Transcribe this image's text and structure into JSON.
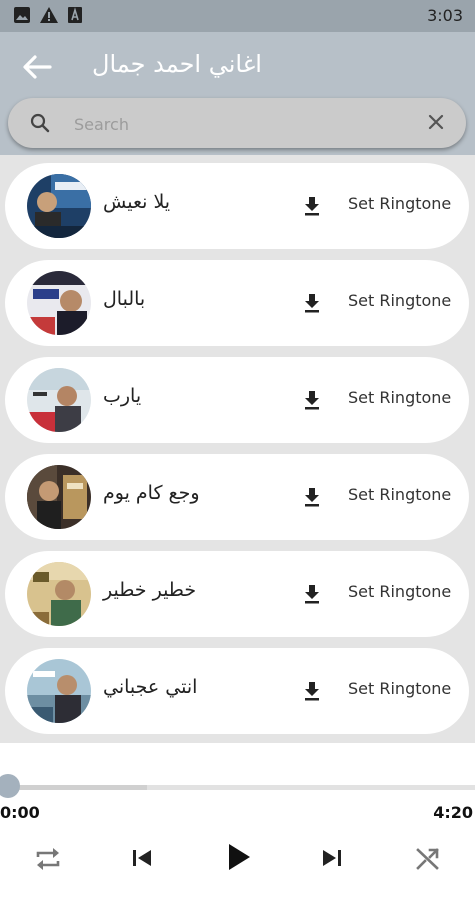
{
  "status_bar": {
    "time": "3:03"
  },
  "app_bar": {
    "title": "اغاني احمد جمال"
  },
  "search": {
    "placeholder": "Search"
  },
  "songs": [
    {
      "title": "يلا نعيش",
      "action": "Set Ringtone"
    },
    {
      "title": "بالبال",
      "action": "Set Ringtone"
    },
    {
      "title": "يارب",
      "action": "Set Ringtone"
    },
    {
      "title": "وجع كام يوم",
      "action": "Set Ringtone"
    },
    {
      "title": "خطير خطير",
      "action": "Set Ringtone"
    },
    {
      "title": "انتي عجباني",
      "action": "Set Ringtone"
    }
  ],
  "player": {
    "current_time": "0:00",
    "duration": "4:20",
    "progress": 0.0,
    "buffered": 0.31
  },
  "colors": {
    "app_bar": "#b7c0c8",
    "status_bar": "#9aa4ac",
    "accent": "#a4b1bd",
    "background": "#e4e4e4"
  }
}
